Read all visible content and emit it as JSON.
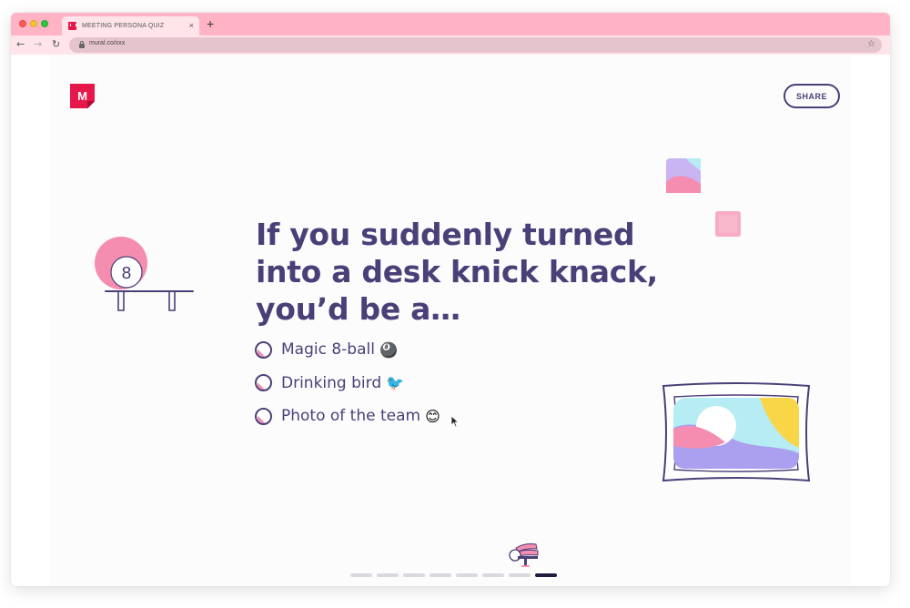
{
  "browser": {
    "tab_title": "MEETING PERSONA QUIZ",
    "tab_close": "×",
    "new_tab": "+",
    "url": "mural.co/xxx",
    "back_icon": "←",
    "forward_icon": "→",
    "reload_icon": "↻",
    "star_icon": "☆"
  },
  "header": {
    "logo_letter": "M",
    "share_label": "SHARE"
  },
  "quiz": {
    "question": "If you suddenly turned into a desk knick knack, you’d be a…",
    "options": [
      {
        "label": "Magic 8-ball",
        "emoji": "🎱"
      },
      {
        "label": "Drinking bird",
        "emoji": "🐦"
      },
      {
        "label": "Photo of the team",
        "emoji": "😊"
      }
    ]
  },
  "illustrations": {
    "eight_ball_number": "8"
  },
  "progress": {
    "total_steps": 8,
    "current_step": 8
  },
  "colors": {
    "titlebar": "#ffb3c4",
    "toolbar": "#ffe4ea",
    "brand": "#e8174a",
    "text_primary": "#4b3f78",
    "accent_pink": "#f58db0",
    "progress_active": "#201c3d",
    "progress_inactive": "#d9d9e0"
  }
}
